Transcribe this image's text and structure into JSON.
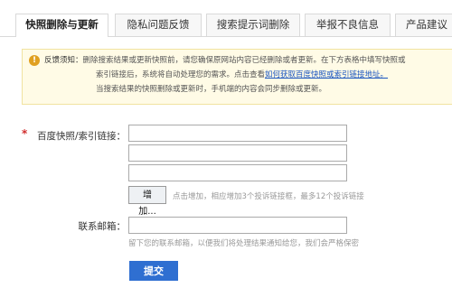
{
  "tabs": [
    {
      "label": "快照删除与更新",
      "active": true
    },
    {
      "label": "隐私问题反馈",
      "active": false
    },
    {
      "label": "搜索提示词删除",
      "active": false
    },
    {
      "label": "举报不良信息",
      "active": false
    },
    {
      "label": "产品建议",
      "active": false
    }
  ],
  "notice": {
    "icon": "info-icon",
    "label": "反馈须知：",
    "line1": "删除搜索结果或更新快照前，请您确保原网站内容已经删除或者更新。在下方表格中填写快照或",
    "line2_prefix": "索引链接后，系统将自动处理您的需求。点击查看",
    "line2_link": "如何获取百度快照或索引链接地址。",
    "line3": "当搜索结果的快照删除或更新时，手机端的内容会同步删除或更新。"
  },
  "form": {
    "required_mark": "*",
    "link_label": "百度快照/索引链接：",
    "add_button": "增加...",
    "add_hint": "点击增加，相应增加3个投诉链接框，最多12个投诉链接",
    "email_label": "联系邮箱：",
    "email_hint": "留下您的联系邮箱，以便我们将处理结果通知给您，我们会严格保密",
    "submit_button": "提交"
  },
  "colors": {
    "accent": "#2f6fd1",
    "required": "#d12e2e",
    "notice_bg": "#fffbe6",
    "link": "#1a55c0"
  }
}
